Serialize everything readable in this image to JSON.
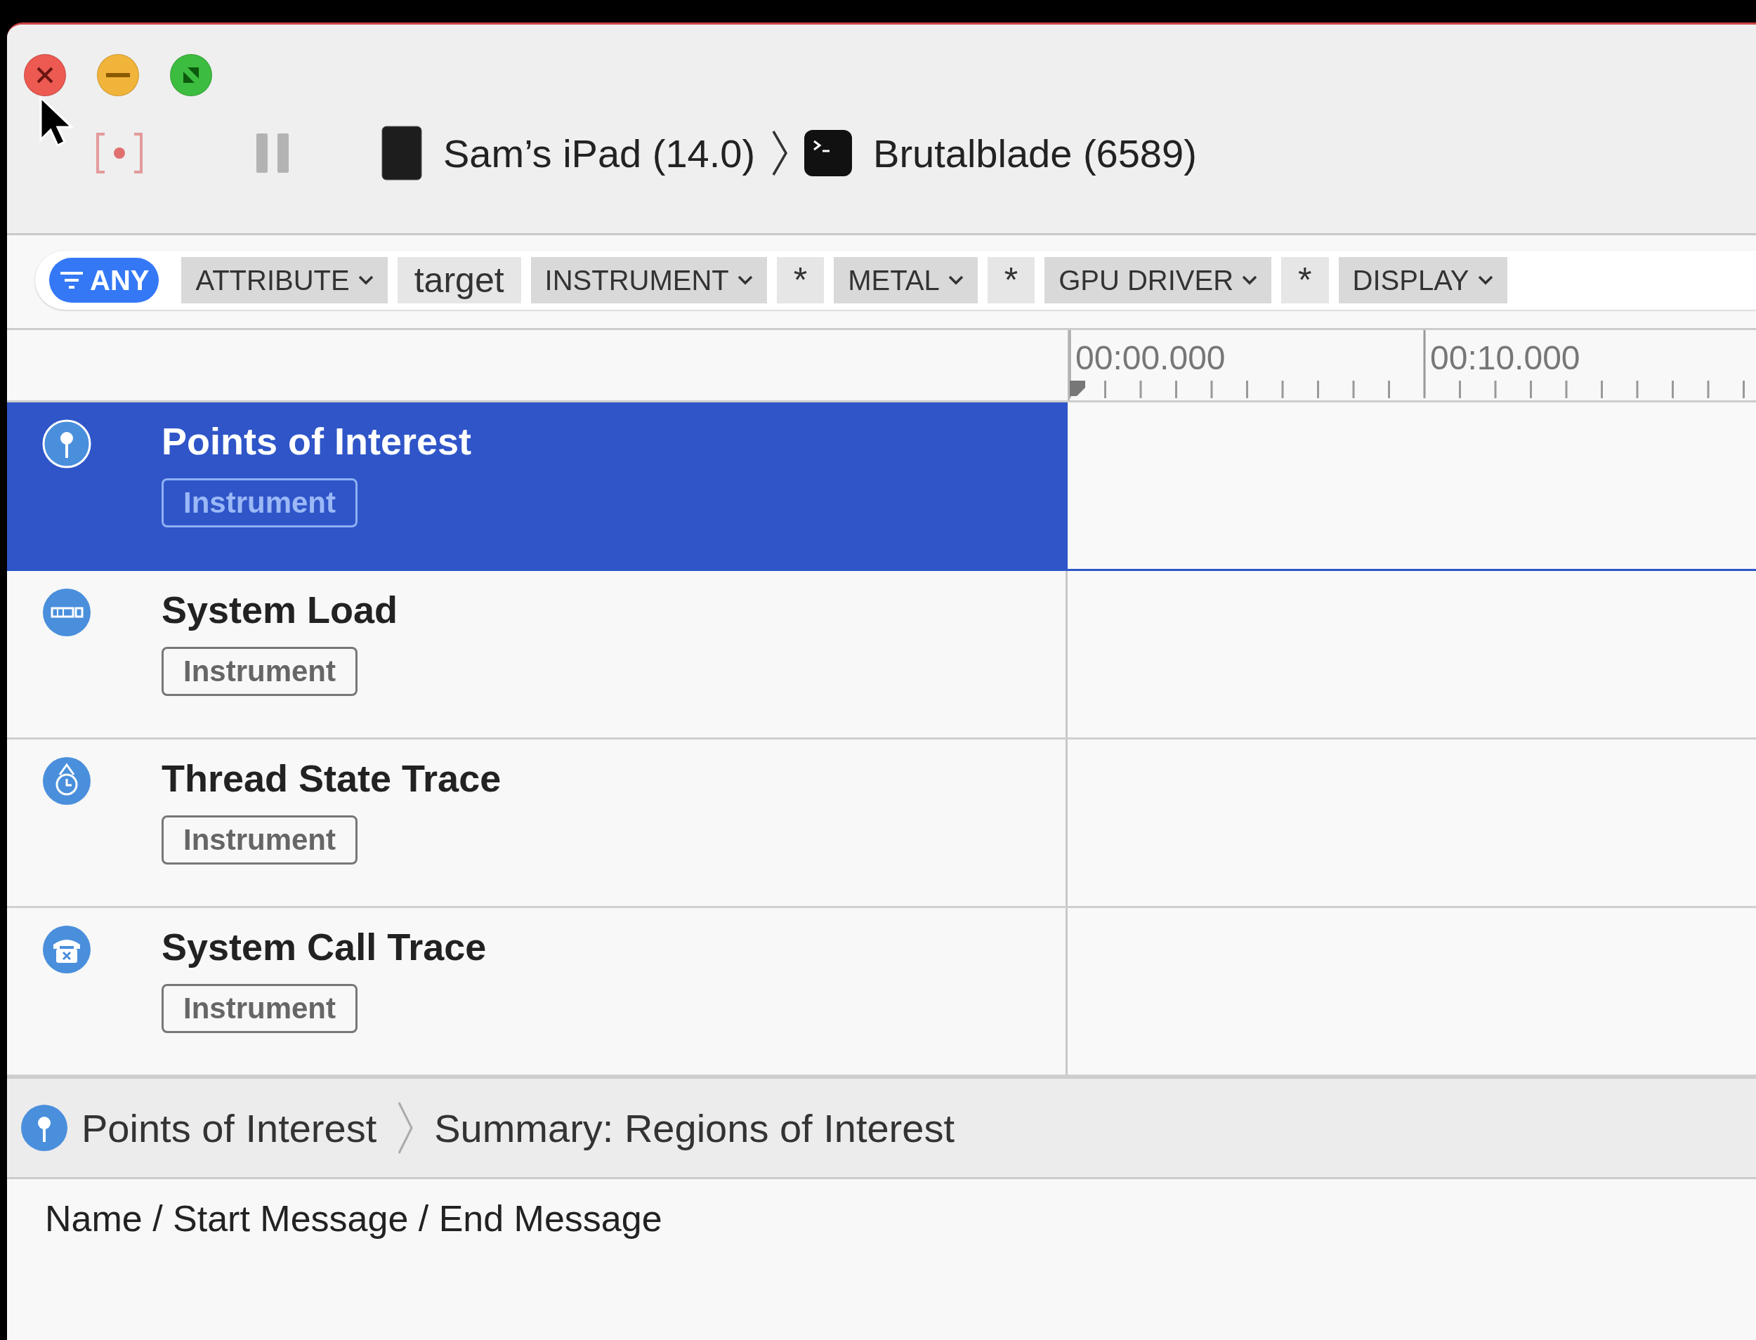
{
  "window": {
    "controls": [
      {
        "kind": "close"
      },
      {
        "kind": "minimize"
      },
      {
        "kind": "zoom"
      }
    ]
  },
  "toolbar": {
    "device": "Sam’s iPad (14.0)",
    "process": "Brutalblade (6589)"
  },
  "filter": {
    "scope": "ANY",
    "tokens": [
      {
        "kind": "dropdown",
        "label": "ATTRIBUTE"
      },
      {
        "kind": "value",
        "label": "target"
      },
      {
        "kind": "dropdown",
        "label": "INSTRUMENT"
      },
      {
        "kind": "value",
        "label": "*"
      },
      {
        "kind": "dropdown",
        "label": "METAL"
      },
      {
        "kind": "value",
        "label": "*"
      },
      {
        "kind": "dropdown",
        "label": "GPU DRIVER"
      },
      {
        "kind": "value",
        "label": "*"
      },
      {
        "kind": "dropdown",
        "label": "DISPLAY"
      }
    ]
  },
  "timeline": {
    "ticks": [
      "00:00.000",
      "00:10.000"
    ]
  },
  "tracks": [
    {
      "kind": "pin",
      "name": "Points of Interest",
      "tag": "Instrument",
      "selected": true
    },
    {
      "kind": "load",
      "name": "System Load",
      "tag": "Instrument",
      "selected": false
    },
    {
      "kind": "thread",
      "name": "Thread State Trace",
      "tag": "Instrument",
      "selected": false
    },
    {
      "kind": "syscall",
      "name": "System Call Trace",
      "tag": "Instrument",
      "selected": false
    }
  ],
  "detail": {
    "breadcrumb": [
      "Points of Interest",
      "Summary: Regions of Interest"
    ],
    "column": "Name / Start Message / End Message"
  }
}
